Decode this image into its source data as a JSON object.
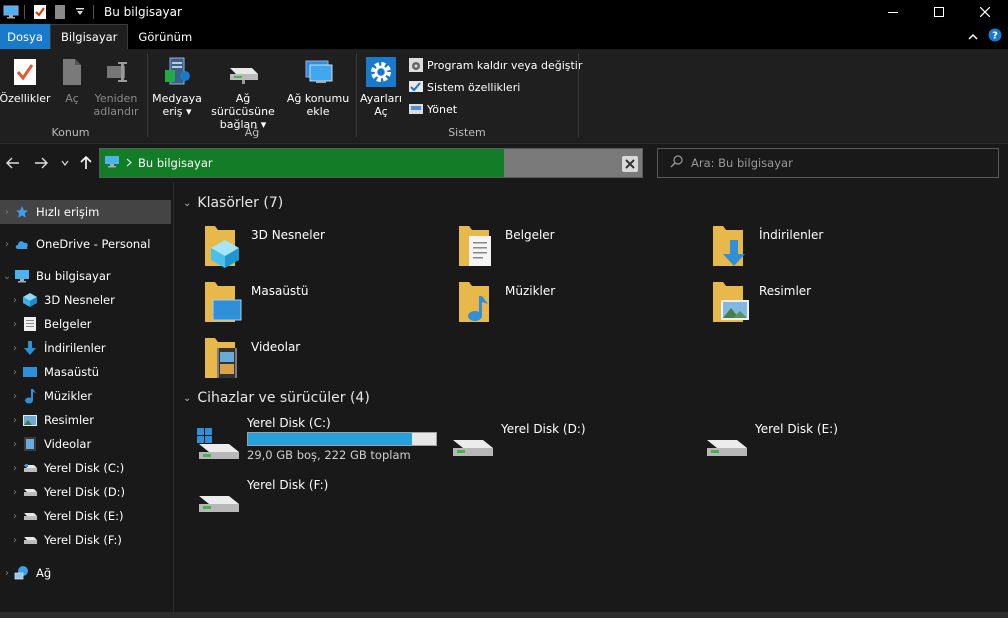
{
  "window": {
    "title": "Bu bilgisayar"
  },
  "ribbon_tabs": [
    {
      "label": "Dosya"
    },
    {
      "label": "Bilgisayar"
    },
    {
      "label": "Görünüm"
    }
  ],
  "ribbon": {
    "konum": {
      "label": "Konum",
      "buttons": [
        {
          "label1": "Özellikler",
          "label2": ""
        },
        {
          "label1": "Aç",
          "label2": ""
        },
        {
          "label1": "Yeniden",
          "label2": "adlandır"
        }
      ]
    },
    "ag": {
      "label": "Ağ",
      "buttons": [
        {
          "label1": "Medyaya",
          "label2": "eriş ▾"
        },
        {
          "label1": "Ağ sürücüsüne",
          "label2": "bağlan ▾"
        },
        {
          "label1": "Ağ konumu",
          "label2": "ekle"
        }
      ]
    },
    "sistem": {
      "label": "Sistem",
      "settings_button": {
        "label1": "Ayarları",
        "label2": "Aç"
      },
      "rows": [
        {
          "label": "Program kaldır veya değiştir"
        },
        {
          "label": "Sistem özellikleri"
        },
        {
          "label": "Yönet"
        }
      ]
    }
  },
  "address": {
    "path": "Bu bilgisayar",
    "search_placeholder": "Ara: Bu bilgisayar"
  },
  "nav_pane": [
    {
      "label": "Hızlı erişim",
      "icon": "star-icon",
      "selected": true
    },
    {
      "label": "OneDrive - Personal",
      "icon": "cloud-icon"
    },
    {
      "label": "Bu bilgisayar",
      "icon": "computer-icon"
    },
    {
      "label": "3D Nesneler",
      "icon": "3d-objects-icon"
    },
    {
      "label": "Belgeler",
      "icon": "documents-icon"
    },
    {
      "label": "İndirilenler",
      "icon": "download-icon"
    },
    {
      "label": "Masaüstü",
      "icon": "desktop-icon"
    },
    {
      "label": "Müzikler",
      "icon": "music-icon"
    },
    {
      "label": "Resimler",
      "icon": "pictures-icon"
    },
    {
      "label": "Videolar",
      "icon": "videos-icon"
    },
    {
      "label": "Yerel Disk (C:)",
      "icon": "drive-icon"
    },
    {
      "label": "Yerel Disk (D:)",
      "icon": "drive-icon"
    },
    {
      "label": "Yerel Disk (E:)",
      "icon": "drive-icon"
    },
    {
      "label": "Yerel Disk (F:)",
      "icon": "drive-icon"
    },
    {
      "label": "Ağ",
      "icon": "network-icon"
    }
  ],
  "folders_section": {
    "heading": "Klasörler (7)",
    "items": [
      {
        "label": "3D Nesneler"
      },
      {
        "label": "Belgeler"
      },
      {
        "label": "İndirilenler"
      },
      {
        "label": "Masaüstü"
      },
      {
        "label": "Müzikler"
      },
      {
        "label": "Resimler"
      },
      {
        "label": "Videolar"
      }
    ]
  },
  "drives_section": {
    "heading": "Cihazlar ve sürücüler (4)",
    "items": [
      {
        "label": "Yerel Disk (C:)",
        "info": "29,0 GB boş, 222 GB toplam",
        "used_fraction": 0.87
      },
      {
        "label": "Yerel Disk (D:)"
      },
      {
        "label": "Yerel Disk (E:)"
      },
      {
        "label": "Yerel Disk (F:)"
      }
    ]
  },
  "colors": {
    "accent": "#1979ca",
    "address_progress": "#127c26",
    "drive_bar": "#26a0da"
  }
}
